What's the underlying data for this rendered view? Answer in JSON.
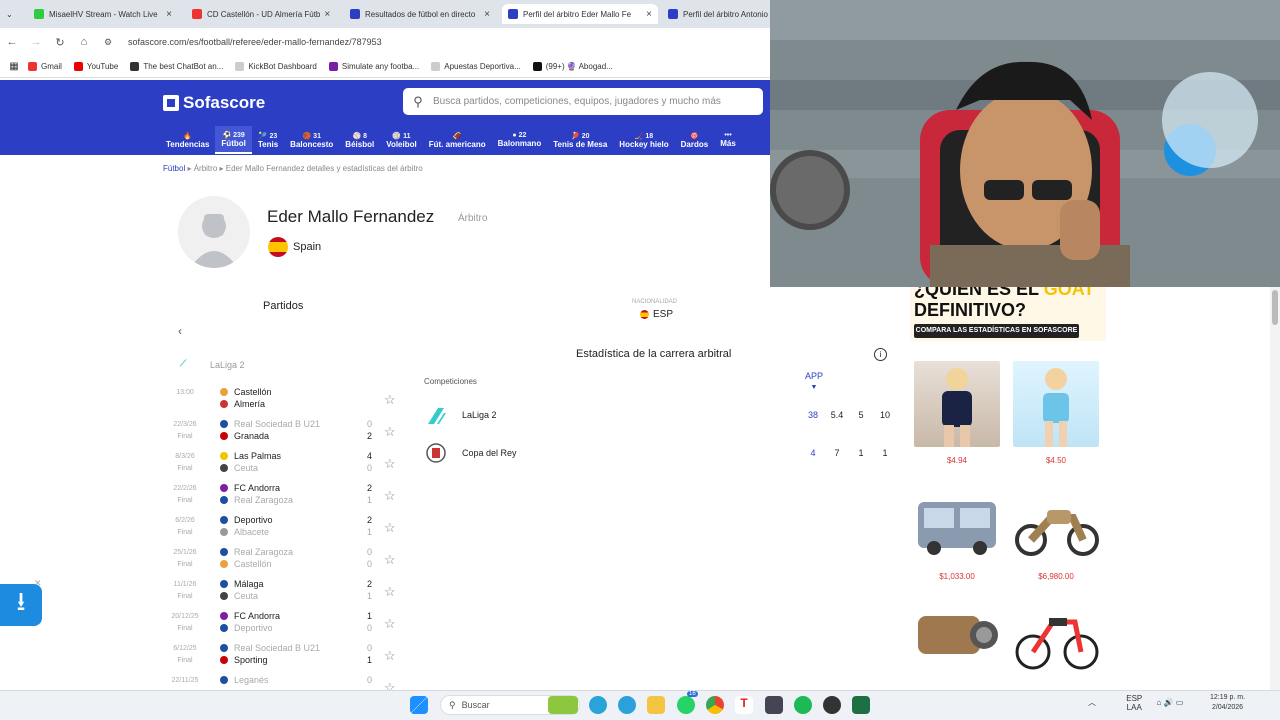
{
  "browser": {
    "tabs": [
      {
        "title": "MisaelHV Stream - Watch Live",
        "color": "#2ecc40"
      },
      {
        "title": "CD Castellón - UD Almería Fútb",
        "color": "#e33"
      },
      {
        "title": "Resultados de fútbol en directo",
        "color": "#2c3ec4"
      },
      {
        "title": "Perfil del árbitro Eder Mallo Fe",
        "color": "#2c3ec4"
      },
      {
        "title": "Perfil del árbitro Antonio",
        "color": "#2c3ec4"
      }
    ],
    "url": "sofascore.com/es/football/referee/eder-mallo-fernandez/787953",
    "bookmarks": [
      {
        "label": "Gmail",
        "color": "#e33"
      },
      {
        "label": "YouTube",
        "color": "#e00"
      },
      {
        "label": "The best ChatBot an...",
        "color": "#333"
      },
      {
        "label": "KickBot Dashboard",
        "color": "#ccc"
      },
      {
        "label": "Simulate any footba...",
        "color": "#7a1fa2"
      },
      {
        "label": "Apuestas Deportiva...",
        "color": "#ccc"
      },
      {
        "label": "(99+) 🔮 Abogad...",
        "color": "#111"
      }
    ]
  },
  "sofascore": {
    "logo": "Sofascore",
    "search_placeholder": "Busca partidos, competiciones, equipos, jugadores y mucho más",
    "sports": [
      {
        "label": "Tendencias",
        "count": ""
      },
      {
        "label": "Fútbol",
        "count": "239"
      },
      {
        "label": "Tenis",
        "count": "23"
      },
      {
        "label": "Baloncesto",
        "count": "31"
      },
      {
        "label": "Béisbol",
        "count": "8"
      },
      {
        "label": "Voleibol",
        "count": "11"
      },
      {
        "label": "Fút. americano",
        "count": ""
      },
      {
        "label": "Balonmano",
        "count": "22"
      },
      {
        "label": "Tenis de Mesa",
        "count": "20"
      },
      {
        "label": "Hockey hielo",
        "count": "18"
      },
      {
        "label": "Dardos",
        "count": ""
      },
      {
        "label": "Más",
        "count": ""
      }
    ],
    "breadcrumb": {
      "first": "Fútbol",
      "second": "Árbitro",
      "third": "Eder Mallo Fernandez detalles y estadísticas del árbitro"
    },
    "referee": {
      "name": "Eder Mallo Fernandez",
      "role": "Árbitro",
      "country": "Spain",
      "nationality_label": "NACIONALIDAD",
      "nationality": "ESP"
    },
    "matches_title": "Partidos",
    "league": "LaLiga 2",
    "matches": [
      {
        "date": "13:00",
        "status": "",
        "home": "Castellón",
        "away": "Almería",
        "hs": "",
        "as": "",
        "hc": "#e9a23b",
        "ac": "#c33"
      },
      {
        "date": "22/3/26",
        "status": "Final",
        "home": "Real Sociedad B U21",
        "away": "Granada",
        "hs": "0",
        "as": "2",
        "hc": "#1d4fa0",
        "ac": "#c00",
        "homeGray": true
      },
      {
        "date": "8/3/26",
        "status": "Final",
        "home": "Las Palmas",
        "away": "Ceuta",
        "hs": "4",
        "as": "0",
        "hc": "#f5c400",
        "ac": "#444",
        "awayGray": true
      },
      {
        "date": "22/2/26",
        "status": "Final",
        "home": "FC Andorra",
        "away": "Real Zaragoza",
        "hs": "2",
        "as": "1",
        "hc": "#7a1fa2",
        "ac": "#1d4fa0",
        "awayGray": true
      },
      {
        "date": "6/2/26",
        "status": "Final",
        "home": "Deportivo",
        "away": "Albacete",
        "hs": "2",
        "as": "1",
        "hc": "#1d4fa0",
        "ac": "#999",
        "awayGray": true
      },
      {
        "date": "25/1/26",
        "status": "Final",
        "home": "Real Zaragoza",
        "away": "Castellón",
        "hs": "0",
        "as": "0",
        "hc": "#1d4fa0",
        "ac": "#e9a23b",
        "homeGray": true,
        "awayGray": true
      },
      {
        "date": "11/1/26",
        "status": "Final",
        "home": "Málaga",
        "away": "Ceuta",
        "hs": "2",
        "as": "1",
        "hc": "#1d4fa0",
        "ac": "#444",
        "awayGray": true
      },
      {
        "date": "20/12/25",
        "status": "Final",
        "home": "FC Andorra",
        "away": "Deportivo",
        "hs": "1",
        "as": "0",
        "hc": "#7a1fa2",
        "ac": "#1d4fa0",
        "awayGray": true
      },
      {
        "date": "6/12/25",
        "status": "Final",
        "home": "Real Sociedad B U21",
        "away": "Sporting",
        "hs": "0",
        "as": "1",
        "hc": "#1d4fa0",
        "ac": "#c00",
        "homeGray": true
      },
      {
        "date": "22/11/25",
        "status": "",
        "home": "Leganés",
        "away": "",
        "hs": "0",
        "as": "",
        "hc": "#1d4fa0",
        "ac": "#fff",
        "homeGray": true
      }
    ],
    "stats": {
      "title": "Estadística de la carrera arbitral",
      "comp_header": "Competiciones",
      "app_header": "APP",
      "rows": [
        {
          "name": "LaLiga 2",
          "vals": [
            "38",
            "5.4",
            "5",
            "10"
          ]
        },
        {
          "name": "Copa del Rey",
          "vals": [
            "4",
            "7",
            "1",
            "1"
          ]
        }
      ]
    }
  },
  "ads": {
    "line1": "¿QUIÉN ES EL ",
    "line1_accent": "GOAT",
    "line2": "DEFINITIVO?",
    "button": "COMPARA LAS ESTADÍSTICAS EN SOFASCORE",
    "prices": [
      "$4.94",
      "$4.50",
      "$1,033.00",
      "$6,980.00"
    ]
  },
  "taskbar": {
    "search": "Buscar",
    "lang1": "ESP",
    "lang2": "LAA",
    "time": "12:19 p. m.",
    "date": "2/04/2026",
    "badge": "16"
  }
}
